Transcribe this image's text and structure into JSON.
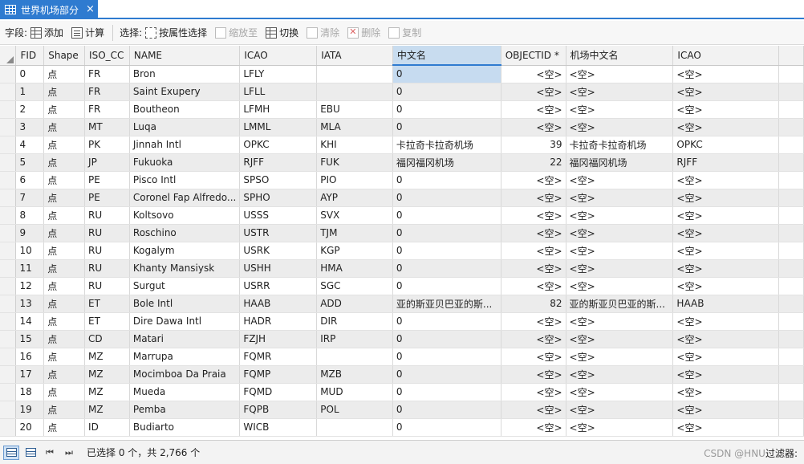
{
  "tab": {
    "title": "世界机场部分",
    "close": "×"
  },
  "toolbar": {
    "fields_label": "字段:",
    "add_label": "添加",
    "calculate_label": "计算",
    "selection_label": "选择:",
    "select_by_attributes_label": "按属性选择",
    "zoom_to_label": "缩放至",
    "switch_label": "切换",
    "clear_label": "清除",
    "delete_label": "删除",
    "copy_label": "复制"
  },
  "table": {
    "columns": [
      "FID",
      "Shape",
      "ISO_CC",
      "NAME",
      "ICAO",
      "IATA",
      "中文名",
      "OBJECTID *",
      "机场中文名",
      "ICAO"
    ],
    "rows": [
      [
        "0",
        "点",
        "FR",
        "Bron",
        "LFLY",
        "",
        "0",
        "<空>",
        "<空>",
        "<空>"
      ],
      [
        "1",
        "点",
        "FR",
        "Saint Exupery",
        "LFLL",
        "",
        "0",
        "<空>",
        "<空>",
        "<空>"
      ],
      [
        "2",
        "点",
        "FR",
        "Boutheon",
        "LFMH",
        "EBU",
        "0",
        "<空>",
        "<空>",
        "<空>"
      ],
      [
        "3",
        "点",
        "MT",
        "Luqa",
        "LMML",
        "MLA",
        "0",
        "<空>",
        "<空>",
        "<空>"
      ],
      [
        "4",
        "点",
        "PK",
        "Jinnah Intl",
        "OPKC",
        "KHI",
        "卡拉奇卡拉奇机场",
        "39",
        "卡拉奇卡拉奇机场",
        "OPKC"
      ],
      [
        "5",
        "点",
        "JP",
        "Fukuoka",
        "RJFF",
        "FUK",
        "福冈福冈机场",
        "22",
        "福冈福冈机场",
        "RJFF"
      ],
      [
        "6",
        "点",
        "PE",
        "Pisco Intl",
        "SPSO",
        "PIO",
        "0",
        "<空>",
        "<空>",
        "<空>"
      ],
      [
        "7",
        "点",
        "PE",
        "Coronel Fap Alfredo...",
        "SPHO",
        "AYP",
        "0",
        "<空>",
        "<空>",
        "<空>"
      ],
      [
        "8",
        "点",
        "RU",
        "Koltsovo",
        "USSS",
        "SVX",
        "0",
        "<空>",
        "<空>",
        "<空>"
      ],
      [
        "9",
        "点",
        "RU",
        "Roschino",
        "USTR",
        "TJM",
        "0",
        "<空>",
        "<空>",
        "<空>"
      ],
      [
        "10",
        "点",
        "RU",
        "Kogalym",
        "USRK",
        "KGP",
        "0",
        "<空>",
        "<空>",
        "<空>"
      ],
      [
        "11",
        "点",
        "RU",
        "Khanty Mansiysk",
        "USHH",
        "HMA",
        "0",
        "<空>",
        "<空>",
        "<空>"
      ],
      [
        "12",
        "点",
        "RU",
        "Surgut",
        "USRR",
        "SGC",
        "0",
        "<空>",
        "<空>",
        "<空>"
      ],
      [
        "13",
        "点",
        "ET",
        "Bole Intl",
        "HAAB",
        "ADD",
        "亚的斯亚贝巴亚的斯...",
        "82",
        "亚的斯亚贝巴亚的斯...",
        "HAAB"
      ],
      [
        "14",
        "点",
        "ET",
        "Dire Dawa Intl",
        "HADR",
        "DIR",
        "0",
        "<空>",
        "<空>",
        "<空>"
      ],
      [
        "15",
        "点",
        "CD",
        "Matari",
        "FZJH",
        "IRP",
        "0",
        "<空>",
        "<空>",
        "<空>"
      ],
      [
        "16",
        "点",
        "MZ",
        "Marrupa",
        "FQMR",
        "",
        "0",
        "<空>",
        "<空>",
        "<空>"
      ],
      [
        "17",
        "点",
        "MZ",
        "Mocimboa Da Praia",
        "FQMP",
        "MZB",
        "0",
        "<空>",
        "<空>",
        "<空>"
      ],
      [
        "18",
        "点",
        "MZ",
        "Mueda",
        "FQMD",
        "MUD",
        "0",
        "<空>",
        "<空>",
        "<空>"
      ],
      [
        "19",
        "点",
        "MZ",
        "Pemba",
        "FQPB",
        "POL",
        "0",
        "<空>",
        "<空>",
        "<空>"
      ],
      [
        "20",
        "点",
        "ID",
        "Budiarto",
        "WICB",
        "",
        "0",
        "<空>",
        "<空>",
        "<空>"
      ]
    ]
  },
  "statusbar": {
    "status_text": "已选择 0 个，共 2,766 个",
    "right_text": "过滤器:",
    "watermark": "CSDN @HNU"
  },
  "colors": {
    "accent": "#2f7bd0",
    "selected_cell": "#c6dbf0",
    "alt_row": "#ececec"
  }
}
